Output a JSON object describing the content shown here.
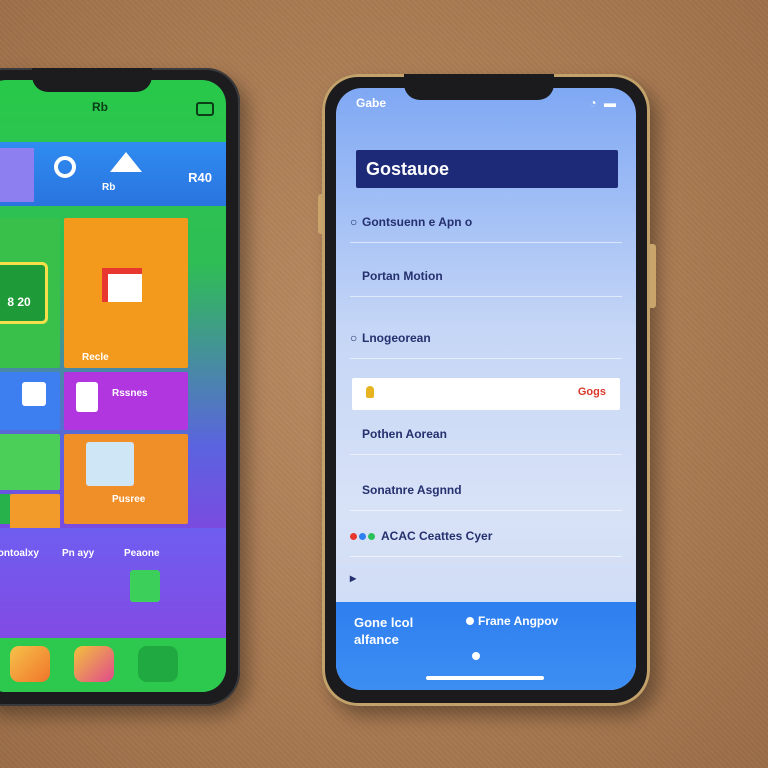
{
  "left_phone": {
    "status_label": "Rb",
    "top_bar": {
      "item_label": "Rb",
      "value": "R40"
    },
    "card_value": "8 20",
    "tile_labels": {
      "orange": "Recle",
      "purple": "Rssnes",
      "orange2": "Pusree",
      "bottom1": "Gontoalxy",
      "bottom2": "Pn ayy",
      "bottom3": "Peaone"
    }
  },
  "right_phone": {
    "status_time": "Gabe",
    "status_icons": "◔ ▬",
    "header_title": "Gostauoe",
    "rows": [
      {
        "lead": "○",
        "label": "Gontsuenn e Apn o"
      },
      {
        "lead": "",
        "label": "Portan Motion"
      },
      {
        "lead": "○",
        "label": "Lnogeorean"
      },
      {
        "lead": "",
        "label": "Pothen Aorean"
      },
      {
        "lead": "",
        "label": "Sonatnre Asgnnd"
      },
      {
        "lead": "",
        "label": "ACAC Ceattes Cyer"
      }
    ],
    "highlight_tag": "Gogs",
    "footer": {
      "left_text": "Gone lcol alfance",
      "right_text": "Frane Angpov"
    }
  },
  "colors": {
    "desk": "#a97a52",
    "right_header": "#1d2a78",
    "right_footer": "#2e7ff0",
    "left_green": "#39c04a",
    "left_orange": "#f39a1c",
    "left_purple": "#b236e0"
  }
}
